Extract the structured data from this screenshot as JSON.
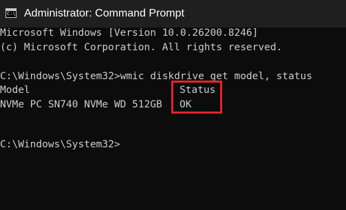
{
  "window": {
    "title": "Administrator: Command Prompt",
    "icon": "command-prompt-icon",
    "icon_glyph": "C:\\",
    "highlight_color": "#e8222a"
  },
  "console": {
    "banner_line1": "Microsoft Windows [Version 10.0.26200.8246]",
    "banner_line2": "(c) Microsoft Corporation. All rights reserved.",
    "command_line": "C:\\Windows\\System32>wmic diskdrive get model, status",
    "header_model": "Model",
    "header_status": "Status",
    "row_model": "NVMe PC SN740 NVMe WD 512GB",
    "row_status": "OK",
    "prompt_line": "C:\\Windows\\System32>"
  }
}
